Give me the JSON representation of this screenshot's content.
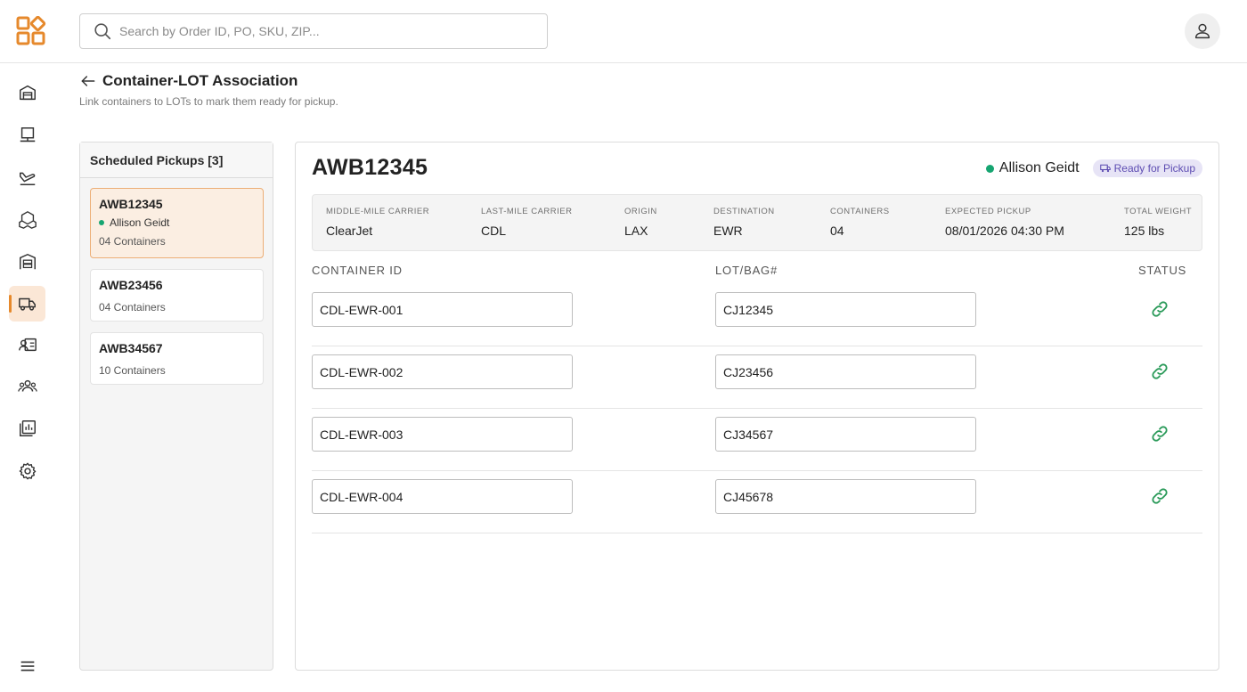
{
  "colors": {
    "accent": "#e6892c",
    "status_green": "#16a571",
    "link_green": "#2a9a59",
    "badge_bg": "#e7e4f6",
    "badge_text": "#5e4db2"
  },
  "search": {
    "placeholder": "Search by Order ID, PO, SKU, ZIP..."
  },
  "header": {
    "logo_icon": "grid-diamond-logo-icon",
    "user_icon": "person-icon"
  },
  "sidebar": {
    "items": [
      {
        "name": "home",
        "icon": "warehouse-icon"
      },
      {
        "name": "monitor",
        "icon": "desk-icon"
      },
      {
        "name": "flights",
        "icon": "plane-icon"
      },
      {
        "name": "packages",
        "icon": "boxes-icon"
      },
      {
        "name": "inventory",
        "icon": "shelves-icon"
      },
      {
        "name": "pickups",
        "icon": "truck-icon",
        "active": true
      },
      {
        "name": "contacts",
        "icon": "id-card-icon"
      },
      {
        "name": "users",
        "icon": "group-icon"
      },
      {
        "name": "reports",
        "icon": "report-icon"
      },
      {
        "name": "settings",
        "icon": "gear-icon"
      }
    ],
    "menu_icon": "hamburger-icon"
  },
  "page": {
    "title": "Container-LOT Association",
    "subtitle": "Link containers to LOTs to mark them ready for pickup."
  },
  "pickups": {
    "header": "Scheduled Pickups [3]",
    "items": [
      {
        "awb": "AWB12345",
        "driver": "Allison Geidt",
        "containers": "04 Containers"
      },
      {
        "awb": "AWB23456",
        "containers": "04 Containers"
      },
      {
        "awb": "AWB34567",
        "containers": "10 Containers"
      }
    ]
  },
  "detail": {
    "awb": "AWB12345",
    "driver": "Allison Geidt",
    "status": "Ready for Pickup",
    "info": {
      "middle_mile_label": "Middle-mile carrier",
      "middle_mile_value": "ClearJet",
      "last_mile_label": "Last-mile carrier",
      "last_mile_value": "CDL",
      "origin_label": "Origin",
      "origin_value": "LAX",
      "destination_label": "Destination",
      "destination_value": "EWR",
      "containers_label": "Containers",
      "containers_value": "04",
      "expected_pickup_label": "Expected pickup",
      "expected_pickup_value": "08/01/2026 04:30 PM",
      "total_weight_label": "Total weight",
      "total_weight_value": "125 lbs"
    },
    "columns": {
      "container_id": "Container ID",
      "lot_bag": "LOT/BAG#",
      "status": "Status"
    },
    "rows": [
      {
        "container_id": "CDL-EWR-001",
        "lot": "CJ12345",
        "status_icon": "link-icon"
      },
      {
        "container_id": "CDL-EWR-002",
        "lot": "CJ23456",
        "status_icon": "link-icon"
      },
      {
        "container_id": "CDL-EWR-003",
        "lot": "CJ34567",
        "status_icon": "link-icon"
      },
      {
        "container_id": "CDL-EWR-004",
        "lot": "CJ45678",
        "status_icon": "link-icon"
      }
    ]
  }
}
